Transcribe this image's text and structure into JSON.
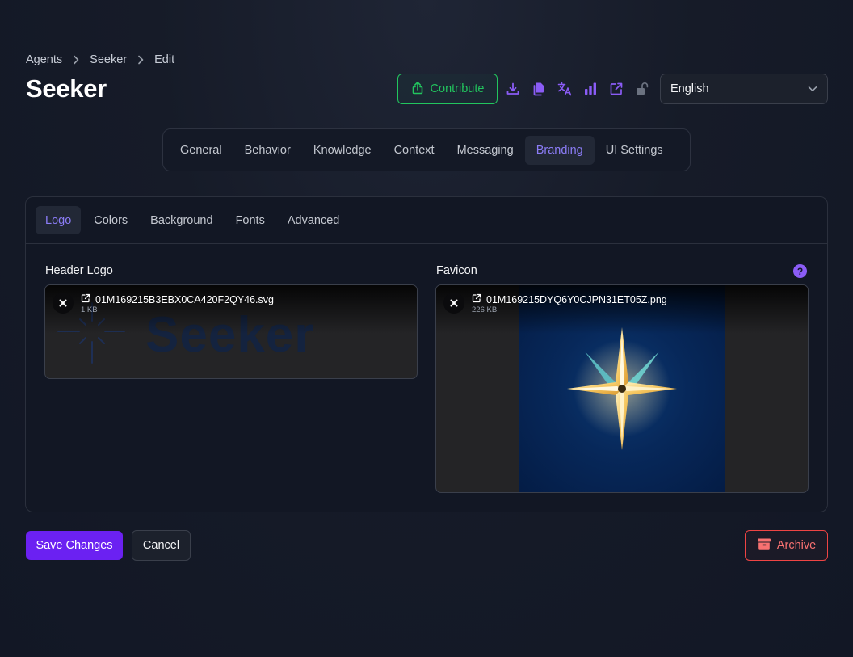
{
  "breadcrumb": [
    "Agents",
    "Seeker",
    "Edit"
  ],
  "page_title": "Seeker",
  "toolbar": {
    "contribute_label": "Contribute",
    "icons": [
      "download-icon",
      "copy-icon",
      "translate-icon",
      "analytics-icon",
      "external-link-icon",
      "unlock-icon"
    ]
  },
  "language": {
    "selected": "English"
  },
  "main_tabs": [
    "General",
    "Behavior",
    "Knowledge",
    "Context",
    "Messaging",
    "Branding",
    "UI Settings"
  ],
  "main_tabs_active": "Branding",
  "sub_tabs": [
    "Logo",
    "Colors",
    "Background",
    "Fonts",
    "Advanced"
  ],
  "sub_tabs_active": "Logo",
  "header_logo": {
    "label": "Header Logo",
    "file_name": "01M169215B3EBX0CA420F2QY46.svg",
    "file_size": "1 KB",
    "preview_text": "Seeker"
  },
  "favicon": {
    "label": "Favicon",
    "file_name": "01M169215DYQ6Y0CJPN31ET05Z.png",
    "file_size": "226 KB",
    "help": "?"
  },
  "actions": {
    "save_label": "Save Changes",
    "cancel_label": "Cancel",
    "archive_label": "Archive"
  },
  "colors": {
    "accent": "#8b5cf6",
    "primary_button": "#6b21f2",
    "contribute": "#22c55e",
    "danger": "#ef4444"
  }
}
